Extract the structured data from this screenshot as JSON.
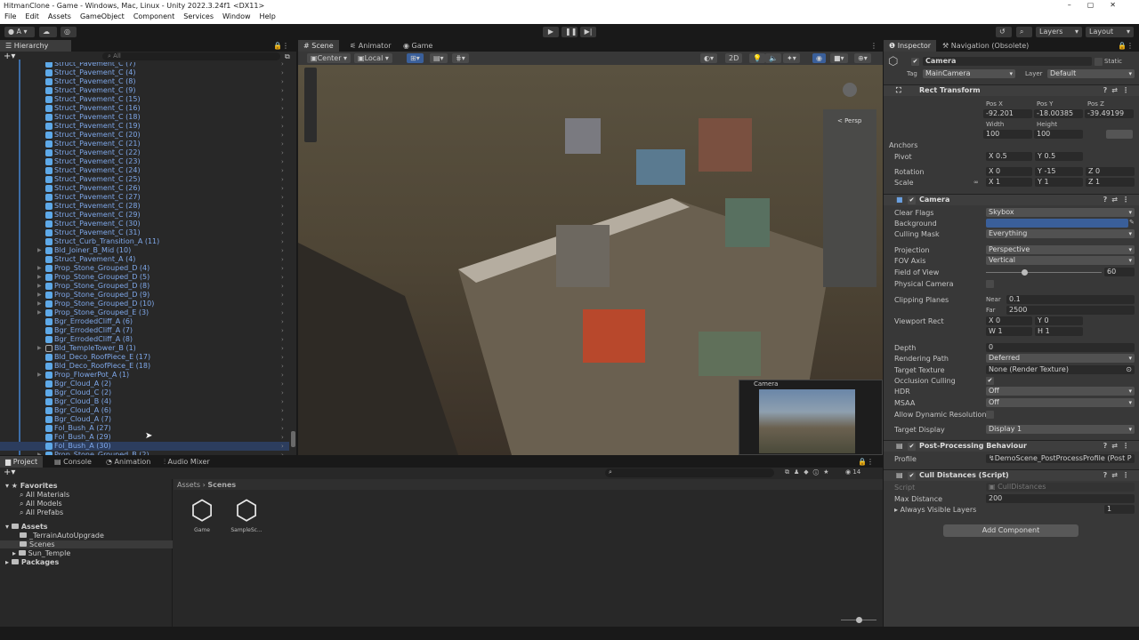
{
  "window": {
    "title": "HitmanClone - Game - Windows, Mac, Linux - Unity 2022.3.24f1 <DX11>"
  },
  "menu": [
    "File",
    "Edit",
    "Assets",
    "GameObject",
    "Component",
    "Services",
    "Window",
    "Help"
  ],
  "toolbar": {
    "account": "A",
    "layers": "Layers",
    "layout": "Layout"
  },
  "hierarchy": {
    "tab": "Hierarchy",
    "search_placeholder": "All",
    "items": [
      {
        "label": "Struct_Pavement_C (7)",
        "expandable": false
      },
      {
        "label": "Struct_Pavement_C (4)",
        "expandable": false
      },
      {
        "label": "Struct_Pavement_C (8)",
        "expandable": false
      },
      {
        "label": "Struct_Pavement_C (9)",
        "expandable": false
      },
      {
        "label": "Struct_Pavement_C (15)",
        "expandable": false
      },
      {
        "label": "Struct_Pavement_C (16)",
        "expandable": false
      },
      {
        "label": "Struct_Pavement_C (18)",
        "expandable": false
      },
      {
        "label": "Struct_Pavement_C (19)",
        "expandable": false
      },
      {
        "label": "Struct_Pavement_C (20)",
        "expandable": false
      },
      {
        "label": "Struct_Pavement_C (21)",
        "expandable": false
      },
      {
        "label": "Struct_Pavement_C (22)",
        "expandable": false
      },
      {
        "label": "Struct_Pavement_C (23)",
        "expandable": false
      },
      {
        "label": "Struct_Pavement_C (24)",
        "expandable": false
      },
      {
        "label": "Struct_Pavement_C (25)",
        "expandable": false
      },
      {
        "label": "Struct_Pavement_C (26)",
        "expandable": false
      },
      {
        "label": "Struct_Pavement_C (27)",
        "expandable": false
      },
      {
        "label": "Struct_Pavement_C (28)",
        "expandable": false
      },
      {
        "label": "Struct_Pavement_C (29)",
        "expandable": false
      },
      {
        "label": "Struct_Pavement_C (30)",
        "expandable": false
      },
      {
        "label": "Struct_Pavement_C (31)",
        "expandable": false
      },
      {
        "label": "Struct_Curb_Transition_A (11)",
        "expandable": false
      },
      {
        "label": "Bld_Joiner_B_Mid (10)",
        "expandable": true
      },
      {
        "label": "Struct_Pavement_A (4)",
        "expandable": false
      },
      {
        "label": "Prop_Stone_Grouped_D (4)",
        "expandable": true
      },
      {
        "label": "Prop_Stone_Grouped_D (5)",
        "expandable": true
      },
      {
        "label": "Prop_Stone_Grouped_D (8)",
        "expandable": true
      },
      {
        "label": "Prop_Stone_Grouped_D (9)",
        "expandable": true
      },
      {
        "label": "Prop_Stone_Grouped_D (10)",
        "expandable": true
      },
      {
        "label": "Prop_Stone_Grouped_E (3)",
        "expandable": true
      },
      {
        "label": "Bgr_ErrodedCliff_A (6)",
        "expandable": false
      },
      {
        "label": "Bgr_ErrodedCliff_A (7)",
        "expandable": false
      },
      {
        "label": "Bgr_ErrodedCliff_A (8)",
        "expandable": false
      },
      {
        "label": "Bld_TempleTower_B (1)",
        "expandable": true,
        "empty": true
      },
      {
        "label": "Bld_Deco_RoofPiece_E (17)",
        "expandable": false
      },
      {
        "label": "Bld_Deco_RoofPiece_E (18)",
        "expandable": false
      },
      {
        "label": "Prop_FlowerPot_A (1)",
        "expandable": true
      },
      {
        "label": "Bgr_Cloud_A (2)",
        "expandable": false
      },
      {
        "label": "Bgr_Cloud_C (2)",
        "expandable": false
      },
      {
        "label": "Bgr_Cloud_B (4)",
        "expandable": false
      },
      {
        "label": "Bgr_Cloud_A (6)",
        "expandable": false
      },
      {
        "label": "Bgr_Cloud_A (7)",
        "expandable": false
      },
      {
        "label": "Fol_Bush_A (27)",
        "expandable": false
      },
      {
        "label": "Fol_Bush_A (29)",
        "expandable": false
      },
      {
        "label": "Fol_Bush_A (30)",
        "expandable": false,
        "selected": true
      },
      {
        "label": "Prop_Stone_Grouped_B (2)",
        "expandable": true
      }
    ]
  },
  "scene": {
    "tabs": [
      "Scene",
      "Animator",
      "Game"
    ],
    "pivot": "Center",
    "space": "Local",
    "mode_2d": "2D",
    "persp": "< Persp",
    "camera_preview": "Camera"
  },
  "inspector": {
    "tabs": [
      "Inspector",
      "Navigation (Obsolete)"
    ],
    "object": {
      "name": "Camera",
      "static": "Static",
      "tag_label": "Tag",
      "tag": "MainCamera",
      "layer_label": "Layer",
      "layer": "Default"
    },
    "rect_transform": {
      "title": "Rect Transform",
      "pos_labels": [
        "Pos X",
        "Pos Y",
        "Pos Z"
      ],
      "pos": [
        "-92.201",
        "-18.00385",
        "-39.49199"
      ],
      "size_labels": [
        "Width",
        "Height"
      ],
      "size": [
        "100",
        "100"
      ],
      "anchors": "Anchors",
      "pivot_label": "Pivot",
      "pivot": [
        "0.5",
        "0.5"
      ],
      "rotation_label": "Rotation",
      "rotation": [
        "0",
        "-15",
        "0"
      ],
      "scale_label": "Scale",
      "scale": [
        "1",
        "1",
        "1"
      ]
    },
    "camera": {
      "title": "Camera",
      "clear_flags": [
        "Clear Flags",
        "Skybox"
      ],
      "background": [
        "Background",
        "#3a5f9a"
      ],
      "culling_mask": [
        "Culling Mask",
        "Everything"
      ],
      "projection": [
        "Projection",
        "Perspective"
      ],
      "fov_axis": [
        "FOV Axis",
        "Vertical"
      ],
      "fov": [
        "Field of View",
        "60"
      ],
      "fov_fraction": 0.33,
      "physical": "Physical Camera",
      "clipping": "Clipping Planes",
      "near_label": "Near",
      "near": "0.1",
      "far_label": "Far",
      "far": "2500",
      "viewport": "Viewport Rect",
      "vx": "0",
      "vy": "0",
      "vw": "1",
      "vh": "1",
      "depth": [
        "Depth",
        "0"
      ],
      "rendering_path": [
        "Rendering Path",
        "Deferred"
      ],
      "target_texture": [
        "Target Texture",
        "None (Render Texture)"
      ],
      "occlusion": "Occlusion Culling",
      "hdr": [
        "HDR",
        "Off"
      ],
      "msaa": [
        "MSAA",
        "Off"
      ],
      "dynres": "Allow Dynamic Resolution",
      "target_display": [
        "Target Display",
        "Display 1"
      ]
    },
    "post": {
      "title": "Post-Processing Behaviour",
      "profile_label": "Profile",
      "profile": "DemoScene_PostProcessProfile (Post P"
    },
    "cull": {
      "title": "Cull Distances (Script)",
      "script_label": "Script",
      "script": "CullDistances",
      "max_label": "Max Distance",
      "max": "200",
      "layers_label": "Always Visible Layers",
      "layers": "1"
    },
    "add_component": "Add Component"
  },
  "bottom": {
    "tabs": [
      "Project",
      "Console",
      "Animation",
      "Audio Mixer"
    ],
    "favorites": "Favorites",
    "fav_items": [
      "All Materials",
      "All Models",
      "All Prefabs"
    ],
    "assets": "Assets",
    "asset_items": [
      "_TerrainAutoUpgrade",
      "Scenes",
      "Sun_Temple"
    ],
    "packages": "Packages",
    "breadcrumb": [
      "Assets",
      "Scenes"
    ],
    "files": [
      "Game",
      "SampleSc..."
    ],
    "hidden_count": "14"
  }
}
